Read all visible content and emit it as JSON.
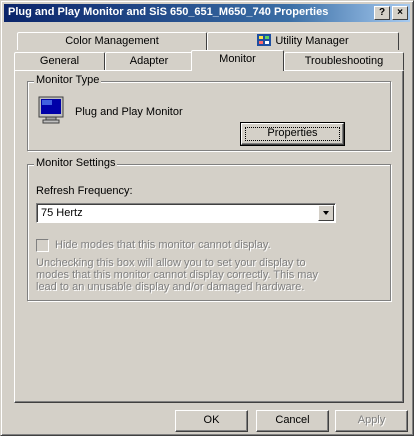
{
  "window": {
    "title": "Plug and Play Monitor and SiS 650_651_M650_740 Properties",
    "help_glyph": "?",
    "close_glyph": "×"
  },
  "tabs": {
    "row1": [
      {
        "label": "Color Management"
      },
      {
        "label": "Utility Manager",
        "icon": "utility-manager-icon"
      }
    ],
    "row2": [
      {
        "label": "General"
      },
      {
        "label": "Adapter"
      },
      {
        "label": "Monitor",
        "active": true
      },
      {
        "label": "Troubleshooting"
      }
    ]
  },
  "monitor_type": {
    "group_label": "Monitor Type",
    "monitor_name": "Plug and Play Monitor",
    "properties_button": "Properties",
    "icon": "monitor-icon"
  },
  "monitor_settings": {
    "group_label": "Monitor Settings",
    "refresh_label": "Refresh Frequency:",
    "refresh_value": "75 Hertz",
    "hide_modes_label": "Hide modes that this monitor cannot display.",
    "hide_modes_checked": false,
    "warning_text": "Unchecking this box will allow you to set your display to modes that this monitor cannot display correctly. This may lead to an unusable display and/or damaged hardware."
  },
  "footer": {
    "ok_label": "OK",
    "cancel_label": "Cancel",
    "apply_label": "Apply"
  },
  "colors": {
    "title_gradient_start": "#0a246a",
    "title_gradient_end": "#a6caf0",
    "face": "#d4d0c8",
    "disabled_text": "#808080"
  }
}
